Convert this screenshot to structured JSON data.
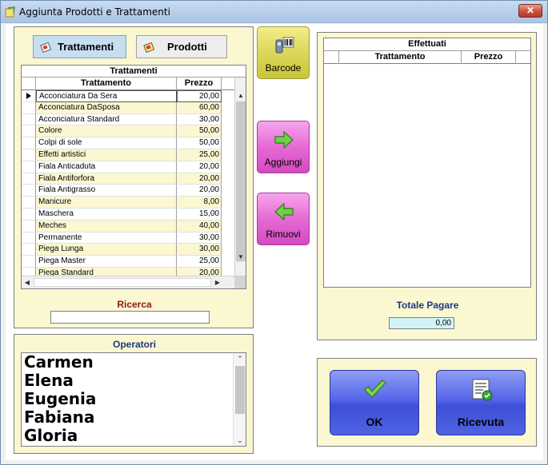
{
  "window": {
    "title": "Aggiunta Prodotti e Trattamenti",
    "close_label": "✕"
  },
  "tabs": {
    "trattamenti": "Trattamenti",
    "prodotti": "Prodotti"
  },
  "left_grid": {
    "caption": "Trattamenti",
    "columns": {
      "name": "Trattamento",
      "price": "Prezzo"
    },
    "rows": [
      {
        "name": "Acconciatura Da Sera",
        "price": "20,00"
      },
      {
        "name": "Acconciatura DaSposa",
        "price": "60,00"
      },
      {
        "name": "Acconciatura Standard",
        "price": "30,00"
      },
      {
        "name": "Colore",
        "price": "50,00"
      },
      {
        "name": "Colpi di sole",
        "price": "50,00"
      },
      {
        "name": "Effetti artistici",
        "price": "25,00"
      },
      {
        "name": "Fiala Anticaduta",
        "price": "20,00"
      },
      {
        "name": "Fiala Antiforfora",
        "price": "20,00"
      },
      {
        "name": "Fiala Antigrasso",
        "price": "20,00"
      },
      {
        "name": "Manicure",
        "price": "8,00"
      },
      {
        "name": "Maschera",
        "price": "15,00"
      },
      {
        "name": "Meches",
        "price": "40,00"
      },
      {
        "name": "Permanente",
        "price": "30,00"
      },
      {
        "name": "Piega Lunga",
        "price": "30,00"
      },
      {
        "name": "Piega Master",
        "price": "25,00"
      },
      {
        "name": "Piega Standard",
        "price": "20,00"
      }
    ]
  },
  "search": {
    "label": "Ricerca",
    "value": ""
  },
  "operators": {
    "label": "Operatori",
    "items": [
      "Carmen",
      "Elena",
      "Eugenia",
      "Fabiana",
      "Gloria"
    ]
  },
  "actions": {
    "barcode": "Barcode",
    "add": "Aggiungi",
    "remove": "Rimuovi"
  },
  "right_grid": {
    "caption": "Effettuati",
    "columns": {
      "name": "Trattamento",
      "price": "Prezzo"
    }
  },
  "total": {
    "label": "Totale Pagare",
    "value": "0,00"
  },
  "buttons": {
    "ok": "OK",
    "receipt": "Ricevuta"
  },
  "colors": {
    "panel": "#fbf7d1",
    "accent_pink": "#e66ad4",
    "accent_yellow": "#dcd75a",
    "accent_blue": "#5566e8"
  }
}
